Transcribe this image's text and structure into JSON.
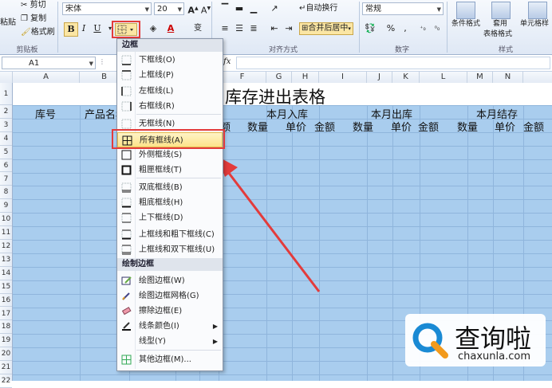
{
  "ribbon": {
    "clipboard": {
      "paste": "粘贴",
      "cut": "剪切",
      "copy": "复制",
      "format_painter": "格式刷",
      "group": "剪贴板"
    },
    "font": {
      "name": "宋体",
      "size": "20",
      "bold": "B",
      "italic": "I",
      "underline": "U",
      "font_color": "A",
      "wen": "变"
    },
    "alignment": {
      "wrap": "自动换行",
      "merge": "合并后居中",
      "group": "对齐方式"
    },
    "number": {
      "format": "常规",
      "percent": "%",
      "comma": ",",
      "group": "数字"
    },
    "styles": {
      "conditional": "条件格式",
      "table_fmt_top": "套用",
      "table_fmt_bottom": "表格格式",
      "cell_style": "单元格样",
      "group": "样式"
    }
  },
  "formula_bar": {
    "name_box": "A1",
    "fx": "fx"
  },
  "columns": [
    "A",
    "B",
    "C",
    "D",
    "E",
    "F",
    "G",
    "H",
    "I",
    "J",
    "K",
    "L",
    "M",
    "N"
  ],
  "rows": [
    "1",
    "2",
    "3",
    "4",
    "5",
    "6",
    "7",
    "8",
    "9",
    "10",
    "11",
    "12",
    "13",
    "14",
    "15",
    "16",
    "17",
    "18",
    "19",
    "20",
    "21",
    "22"
  ],
  "sheet": {
    "title": "库存进出表格",
    "col_ku": "库号",
    "col_name": "产品名称",
    "col_e": "额",
    "group_in": "本月入库",
    "group_out": "本月出库",
    "group_end": "本月结存",
    "qty": "数量",
    "price": "单价",
    "amount": "金额"
  },
  "border_menu": {
    "header": "边框",
    "items": [
      {
        "label": "下框线(O)",
        "icon": "bottom-border-icon"
      },
      {
        "label": "上框线(P)",
        "icon": "top-border-icon"
      },
      {
        "label": "左框线(L)",
        "icon": "left-border-icon"
      },
      {
        "label": "右框线(R)",
        "icon": "right-border-icon"
      },
      {
        "label": "无框线(N)",
        "icon": "no-border-icon"
      },
      {
        "label": "所有框线(A)",
        "icon": "all-borders-icon"
      },
      {
        "label": "外侧框线(S)",
        "icon": "outside-borders-icon"
      },
      {
        "label": "粗匣框线(T)",
        "icon": "thick-box-border-icon"
      },
      {
        "label": "双底框线(B)",
        "icon": "double-bottom-border-icon"
      },
      {
        "label": "粗底框线(H)",
        "icon": "thick-bottom-border-icon"
      },
      {
        "label": "上下框线(D)",
        "icon": "top-bottom-border-icon"
      },
      {
        "label": "上框线和粗下框线(C)",
        "icon": "top-thick-bottom-border-icon"
      },
      {
        "label": "上框线和双下框线(U)",
        "icon": "top-double-bottom-border-icon"
      }
    ],
    "draw_header": "绘制边框",
    "draw_items": [
      {
        "label": "绘图边框(W)",
        "icon": "draw-border-icon"
      },
      {
        "label": "绘图边框网格(G)",
        "icon": "draw-border-grid-icon"
      },
      {
        "label": "擦除边框(E)",
        "icon": "eraser-icon"
      },
      {
        "label": "线条颜色(I)",
        "icon": "line-color-icon"
      },
      {
        "label": "线型(Y)",
        "icon": "line-style-icon"
      },
      {
        "label": "其他边框(M)...",
        "icon": "more-borders-icon"
      }
    ]
  },
  "watermark": {
    "brand": "查询啦",
    "url": "chaxunla.com"
  },
  "colors": {
    "selection": "#a9cdee",
    "highlight_border": "#e33b3b",
    "menu_highlight": "#fde38a"
  }
}
